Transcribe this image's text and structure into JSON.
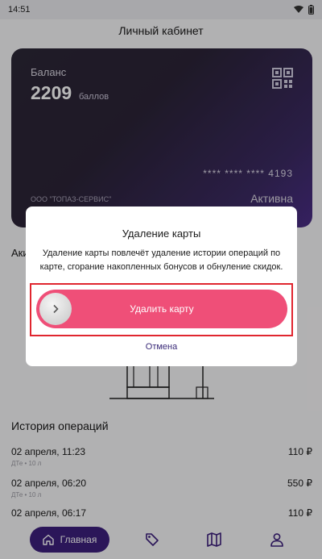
{
  "status_bar": {
    "time": "14:51"
  },
  "header": {
    "title": "Личный кабинет"
  },
  "card": {
    "balance_label": "Баланс",
    "balance_value": "2209",
    "balance_unit": "баллов",
    "card_number": "**** **** **** 4193",
    "company": "ООО \"ТОПАЗ-СЕРВИС\"",
    "status": "Активна"
  },
  "section": {
    "partial_label": "Аки"
  },
  "history": {
    "title": "История операций",
    "items": [
      {
        "date": "02 апреля, 11:23",
        "detail": "ДТе • 10 л",
        "amount": "110 ₽"
      },
      {
        "date": "02 апреля, 06:20",
        "detail": "ДТе • 10 л",
        "amount": "550 ₽"
      },
      {
        "date": "02 апреля, 06:17",
        "detail": "",
        "amount": "110 ₽"
      }
    ]
  },
  "nav": {
    "home_label": "Главная"
  },
  "dialog": {
    "title": "Удаление карты",
    "description": "Удаление карты повлечёт удаление истории операций по карте, сгорание накопленных бонусов и обнуление скидок.",
    "swipe_label": "Удалить карту",
    "cancel_label": "Отмена"
  },
  "colors": {
    "accent": "#3c1f7c",
    "danger_swipe": "#ef4f78",
    "highlight_border": "#e0262f"
  }
}
